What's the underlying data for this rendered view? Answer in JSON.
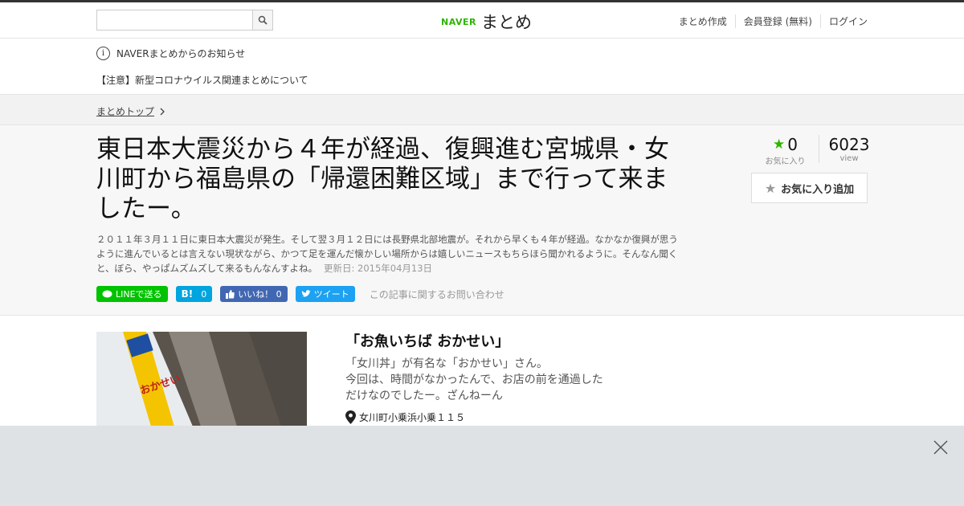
{
  "header": {
    "search_placeholder": "",
    "logo_brand": "NAVER",
    "logo_name": "まとめ",
    "nav": [
      "まとめ作成",
      "会員登録 (無料)",
      "ログイン"
    ]
  },
  "notice": {
    "title": "NAVERまとめからのお知らせ",
    "item": "【注意】新型コロナウイルス関連まとめについて"
  },
  "breadcrumb": {
    "top": "まとめトップ"
  },
  "article": {
    "title": "東日本大震災から４年が経過、復興進む宮城県・女川町から福島県の「帰還困難区域」まで行って来ましたー。",
    "description": "２０１１年３月１１日に東日本大震災が発生。そして翌３月１２日には長野県北部地震が。それから早くも４年が経過。なかなか復興が思うように進んでいるとは言えない現状ながら、かつて足を運んだ懐かしい場所からは嬉しいニュースもちらほら聞かれるように。そんなん聞くと、ぼら、やっぱムズムズして来るもんなんすよね。",
    "updated": "更新日: 2015年04月13日",
    "favorites_count": "0",
    "favorites_label": "お気に入り",
    "views_count": "6023",
    "views_label": "view",
    "fav_button": "お気に入り追加"
  },
  "share": {
    "line": "LINEで送る",
    "hatena_count": "0",
    "fb_like": "いいね！ 0",
    "tweet": "ツイート",
    "inquiry": "この記事に関するお問い合わせ"
  },
  "item": {
    "heading": "「お魚いちば おかせい」",
    "desc_lines": [
      "「女川丼」が有名な「おかせい」さん。",
      "今回は、時間がなかったんで、お店の前を通過した",
      "だけなのでしたー。ざんねーん"
    ],
    "location": "女川町小乗浜小乗１１５",
    "sign_text": "おかせい"
  },
  "colors": {
    "naver_green": "#2db400",
    "line_green": "#00c300",
    "hatena_blue": "#00a4de",
    "fb_blue": "#4267b2",
    "twitter_blue": "#1da1f2"
  }
}
